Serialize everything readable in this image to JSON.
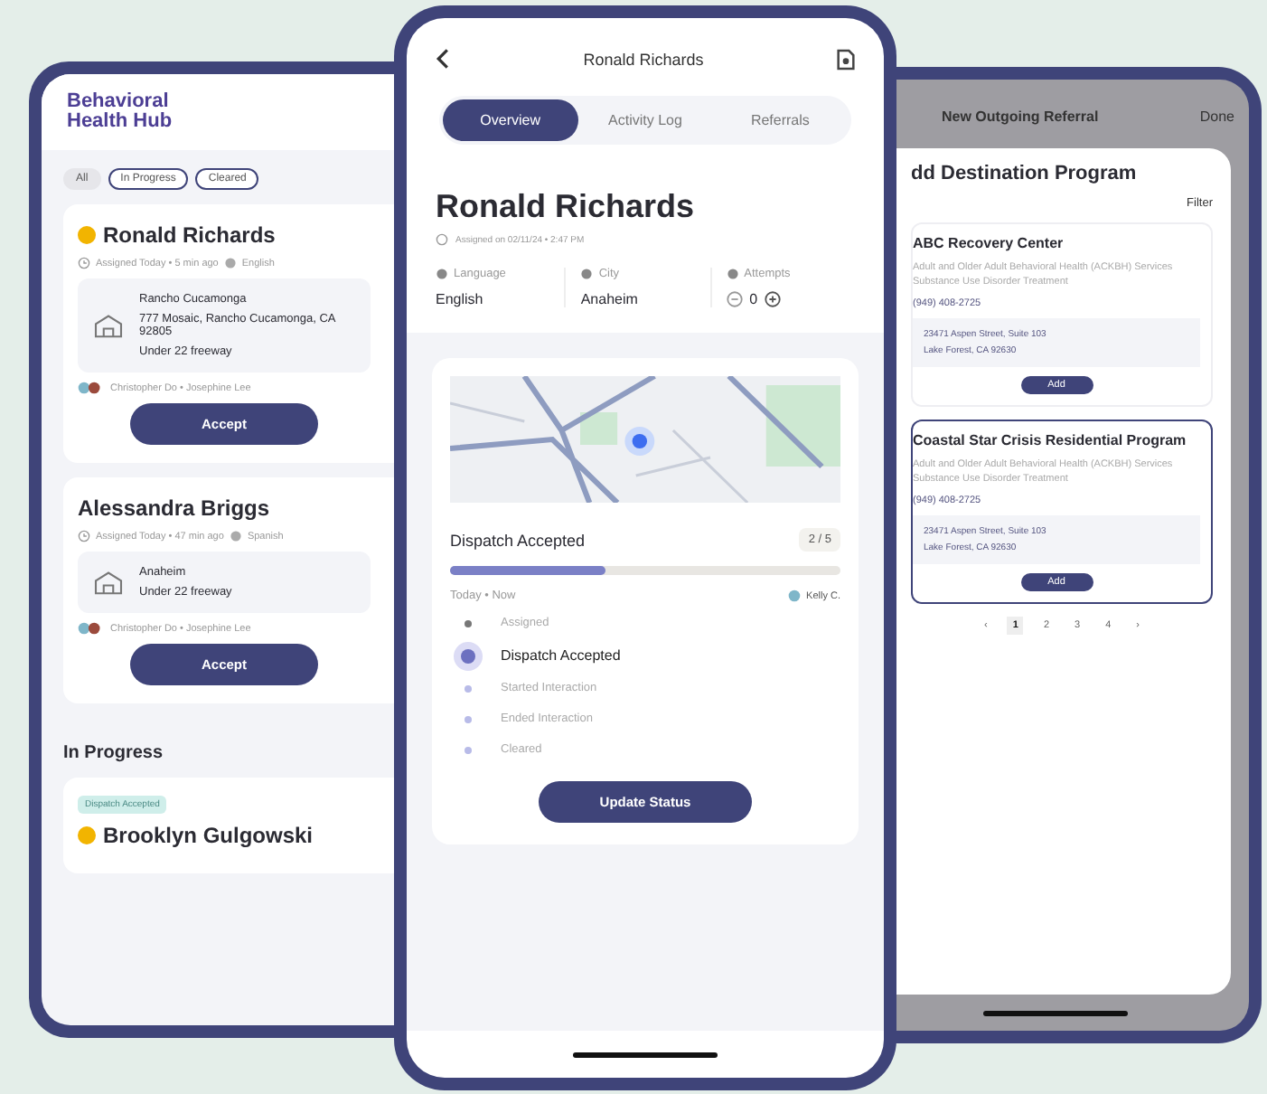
{
  "left_phone": {
    "logo": "Behavioral Health Hub",
    "filters": [
      {
        "label": "All",
        "selected": true
      },
      {
        "label": "In Progress",
        "selected": false
      },
      {
        "label": "Cleared",
        "selected": false
      }
    ],
    "cases": [
      {
        "name": "Ronald Richards",
        "flagged": true,
        "assigned": "Assigned Today • 5 min ago",
        "language": "English",
        "location": [
          "Rancho Cucamonga",
          "777 Mosaic, Rancho Cucamonga, CA 92805",
          "Under 22 freeway"
        ],
        "team": "Christopher Do • Josephine Lee",
        "action": "Accept"
      },
      {
        "name": "Alessandra Briggs",
        "flagged": false,
        "assigned": "Assigned Today • 47 min ago",
        "language": "Spanish",
        "location": [
          "Anaheim",
          "Under 22 freeway"
        ],
        "team": "Christopher Do • Josephine Lee",
        "action": "Accept"
      }
    ],
    "in_progress": {
      "heading": "In Progress",
      "status": "Dispatch Accepted",
      "name": "Brooklyn Gulgowski",
      "flagged": true
    }
  },
  "center_phone": {
    "title": "Ronald Richards",
    "tabs": [
      {
        "label": "Overview",
        "selected": true
      },
      {
        "label": "Activity Log",
        "selected": false
      },
      {
        "label": "Referrals",
        "selected": false
      }
    ],
    "name": "Ronald Richards",
    "assigned": "Assigned on 02/11/24 • 2:47 PM",
    "info": [
      {
        "kind": "text",
        "label": "Language",
        "value": "English"
      },
      {
        "kind": "text",
        "label": "City",
        "value": "Anaheim"
      },
      {
        "kind": "stepper",
        "label": "Attempts",
        "value": "0"
      }
    ],
    "status": {
      "title": "Dispatch Accepted",
      "count": "2 / 5",
      "level": 0.4,
      "time": "Today • Now",
      "agent": "Kelly C.",
      "steps": [
        {
          "label": "Assigned",
          "kind": "done"
        },
        {
          "label": "Dispatch Accepted",
          "kind": "current"
        },
        {
          "label": "Started Interaction",
          "kind": "pending"
        },
        {
          "label": "Ended Interaction",
          "kind": "pending"
        },
        {
          "label": "Cleared",
          "kind": "pending"
        }
      ],
      "action": "Update Status"
    }
  },
  "right_phone": {
    "title": "New Outgoing Referral",
    "done": "Done",
    "heading": "dd Destination Program",
    "filter": "Filter",
    "programs": [
      {
        "name": "ABC Recovery Center",
        "selected": false,
        "description": "Adult and Older Adult Behavioral Health (ACKBH) Services Substance Use Disorder Treatment",
        "phone": "(949) 408-2725",
        "address": [
          "23471 Aspen Street, Suite 103",
          "Lake Forest, CA 92630"
        ],
        "action": "Add"
      },
      {
        "name": "Coastal Star Crisis Residential Program",
        "selected": true,
        "description": "Adult and Older Adult Behavioral Health (ACKBH) Services Substance Use Disorder Treatment",
        "phone": "(949) 408-2725",
        "address": [
          "23471 Aspen Street, Suite 103",
          "Lake Forest, CA 92630"
        ],
        "action": "Add"
      }
    ],
    "pages": [
      {
        "label": "‹",
        "selected": false
      },
      {
        "label": "1",
        "selected": true
      },
      {
        "label": "2",
        "selected": false
      },
      {
        "label": "3",
        "selected": false
      },
      {
        "label": "4",
        "selected": false
      },
      {
        "label": "›",
        "selected": false
      }
    ]
  }
}
